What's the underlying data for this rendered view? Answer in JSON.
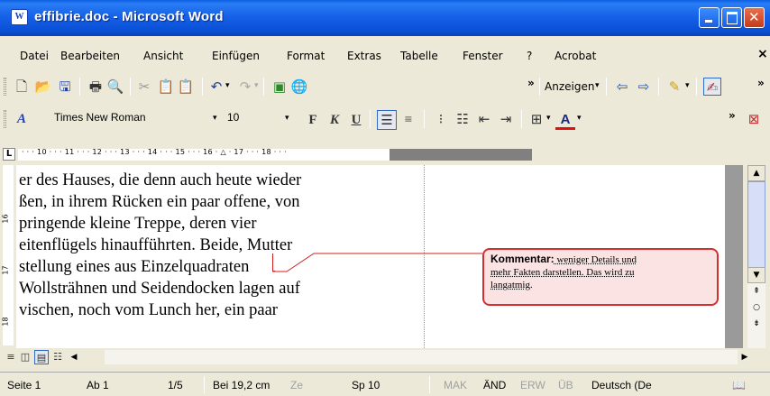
{
  "window": {
    "title": "effibrie.doc - Microsoft Word",
    "app_icon_label": "W"
  },
  "menu": {
    "items": [
      "Datei",
      "Bearbeiten",
      "Ansicht",
      "Einfügen",
      "Format",
      "Extras",
      "Tabelle",
      "Fenster",
      "?",
      "Acrobat"
    ],
    "close_glyph": "×"
  },
  "standard_toolbar": {
    "overflow_glyph": "»",
    "anzeigen_label": "Anzeigen"
  },
  "formatting_toolbar": {
    "font_name": "Times New Roman",
    "font_size": "10",
    "bold": "F",
    "italic": "K",
    "underline": "U"
  },
  "ruler": {
    "ticks": "· · · 10 · · · 11 · · · 12 · · · 13 · · · 14 · · · 15 · · · 16 · △ · 17 · · · 18 · · ·",
    "tab_selector": "L"
  },
  "vertical_ruler": {
    "labels": [
      "16",
      "17",
      "18"
    ]
  },
  "document": {
    "lines": [
      "er des Hauses, die denn auch heute wieder",
      "ßen, in ihrem Rücken ein paar offene, von",
      "pringende kleine Treppe, deren vier",
      "eitenflügels hinaufführten. Beide, Mutter",
      "stellung eines aus Einzelquadraten",
      "Wollsträhnen und Seidendocken lagen auf",
      "vischen, noch vom Lunch her, ein paar"
    ]
  },
  "comment": {
    "label": "Kommentar:",
    "text_part1": " weniger Details und",
    "text_part2": "mehr Fakten darstellen. Das wird zu",
    "text_part3": "langatmig."
  },
  "status_bar": {
    "page": "Seite 1",
    "section": "Ab 1",
    "page_count": "1/5",
    "position": "Bei 19,2 cm",
    "line_label": "Ze",
    "column": "Sp 10",
    "mak": "MAK",
    "aend": "ÄND",
    "erw": "ERW",
    "ueb": "ÜB",
    "language": "Deutsch (De"
  },
  "colors": {
    "titlebar": "#0a4fd6",
    "comment_border": "#d03030",
    "comment_fill": "#fce3e3"
  }
}
